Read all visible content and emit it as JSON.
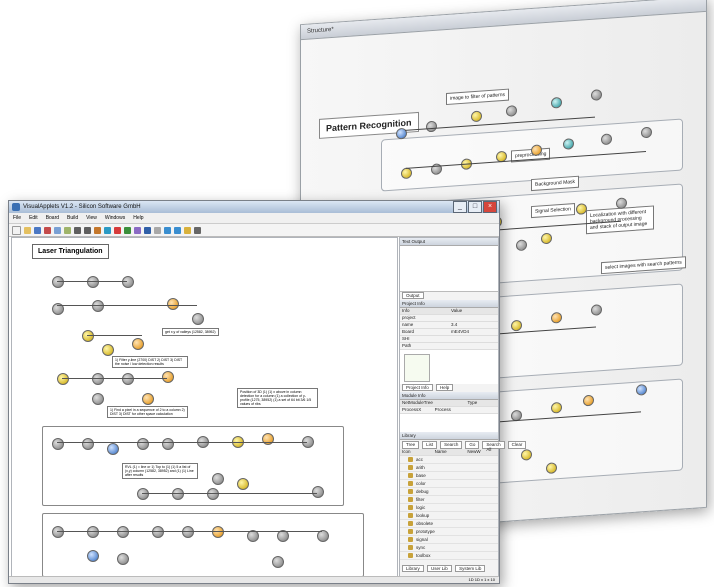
{
  "back_window": {
    "title": "Structure*",
    "heading": "Pattern Recognition",
    "notes": [
      "image to filter of patterns",
      "Background Mask",
      "Signal Selection",
      "preprocessing",
      "Localization with different background processing and stack of output image",
      "select images with search patterns"
    ],
    "controls": {
      "minimize": "_",
      "maximize": "□",
      "close": "×"
    }
  },
  "front_window": {
    "title": "VisualApplets V1.2 - Silicon Software GmbH",
    "menu": [
      "File",
      "Edit",
      "Board",
      "Build",
      "View",
      "Windows",
      "Help"
    ],
    "controls": {
      "minimize": "_",
      "maximize": "□",
      "close": "×"
    },
    "canvas_title": "Laser Triangulation",
    "notes": [
      "get x,y of valleys (12582, 38952)",
      "1) Filter y-line (2700) DIST 2) DIST 3) DIST the noise / low detection results",
      "1) Find a pixel in a sequence of 2 to a column 2) DIST 3) DIST for other space calculation",
      "Position of 3D (1) (1) x above in column detection for a column (1) a collection of y-profile (1275, 38952) (1) a set of 64 bit 3/6 1/5 values of ribs",
      "RVL (1) = line or 1) Top to (1) (1) 5 a list of (x,y) column (12582, 38952) and (1) (1) Line after results"
    ]
  },
  "side_panel": {
    "text_output_title": "Text Output",
    "output_tab": "Output",
    "project_info_title": "Project Info",
    "project_info_cols": [
      "Info",
      "Value"
    ],
    "project_rows": [
      [
        "project",
        ""
      ],
      [
        "name",
        "3.4"
      ],
      [
        "Board",
        "mE4VD4"
      ],
      [
        "SHI",
        ""
      ],
      [
        "Path",
        ""
      ]
    ],
    "tabs1": [
      "Project Info",
      "Help"
    ],
    "module_info_title": "Module Info",
    "module_info_cols": [
      "NetModuleTree",
      "",
      "Type"
    ],
    "module_rows": [
      [
        "ProcessX",
        "Process",
        ""
      ]
    ],
    "library_title": "Library",
    "library_controls": [
      "Tree",
      "List",
      "Search",
      "Go",
      "Search All",
      "Clear"
    ],
    "library_cols": [
      "Icon",
      "Name",
      "NewW"
    ],
    "library_items": [
      "acc",
      "arith",
      "base",
      "color",
      "debug",
      "filter",
      "logic",
      "lookup",
      "obsolete",
      "prototype",
      "signal",
      "sync",
      "toolbox"
    ],
    "tabs2": [
      "Library",
      "User Lib",
      "System Lib"
    ],
    "status": "1D 1D x 1 x 10"
  },
  "colors": {
    "accent_blue": "#3a6fb3",
    "close_red": "#d6463c",
    "node_yellow": "#caa400",
    "node_gray": "#777777",
    "node_blue": "#2f6ac0",
    "node_teal": "#1b8e95"
  }
}
